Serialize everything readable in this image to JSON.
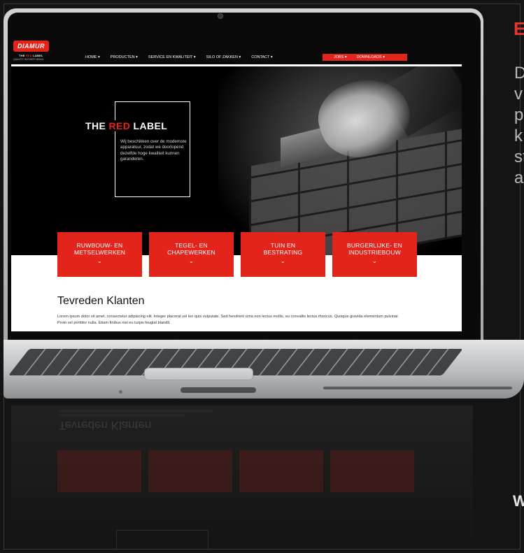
{
  "side": {
    "heading_letter": "E",
    "text_lines": [
      "D",
      "v",
      "p",
      "k",
      "st",
      "a"
    ],
    "footer_letter": "W"
  },
  "site": {
    "logo": {
      "name": "DIAMUR",
      "sub_prefix": "THE ",
      "sub_red": "RED",
      "sub_suffix": " LABEL",
      "sub2": "QUALITY IN EVERY BRICK"
    },
    "nav": [
      {
        "label": "HOME ▾"
      },
      {
        "label": "PRODUCTEN ▾"
      },
      {
        "label": "SERVICE EN KWALITEIT ▾"
      },
      {
        "label": "SILO OF ZAKKEN ▾"
      },
      {
        "label": "CONTACT ▾"
      }
    ],
    "buttons": [
      {
        "label": "JOBS ▾"
      },
      {
        "label": "DOWNLOADS ▾"
      }
    ],
    "hero": {
      "title_prefix": "THE ",
      "title_red": "RED",
      "title_suffix": " LABEL",
      "description": "Wij beschikken over de modernste apparatuur, zodat we doorlopend dezelfde hoge kwaliteit kunnen garanderen."
    },
    "cards": [
      {
        "line1": "RUWBOUW- EN",
        "line2": "METSELWERKEN",
        "chevron": "⌄"
      },
      {
        "line1": "TEGEL- EN",
        "line2": "CHAPEWERKEN",
        "chevron": "⌄"
      },
      {
        "line1": "TUIN EN",
        "line2": "BESTRATING",
        "chevron": "⌄"
      },
      {
        "line1": "BURGERLIJKE- EN",
        "line2": "INDUSTRIEBOUW",
        "chevron": "⌄"
      }
    ],
    "section": {
      "title": "Tevreden Klanten",
      "text": "Lorem ipsum dolor sit amet, consectetur adipiscing elit. Integer placerat vel leo quis vulputate. Sed hendrerit urna non lectus mollis, eu convallis lectus rhoncus. Quisque gravida elementum pulvinar. Proin vel porttitor nulla. Etiam finibus nisl eu turpis feugiat blandit."
    }
  },
  "reflection": {
    "title": "Tevreden Klanten"
  },
  "colors": {
    "accent": "#e3241b",
    "background": "#141414"
  }
}
